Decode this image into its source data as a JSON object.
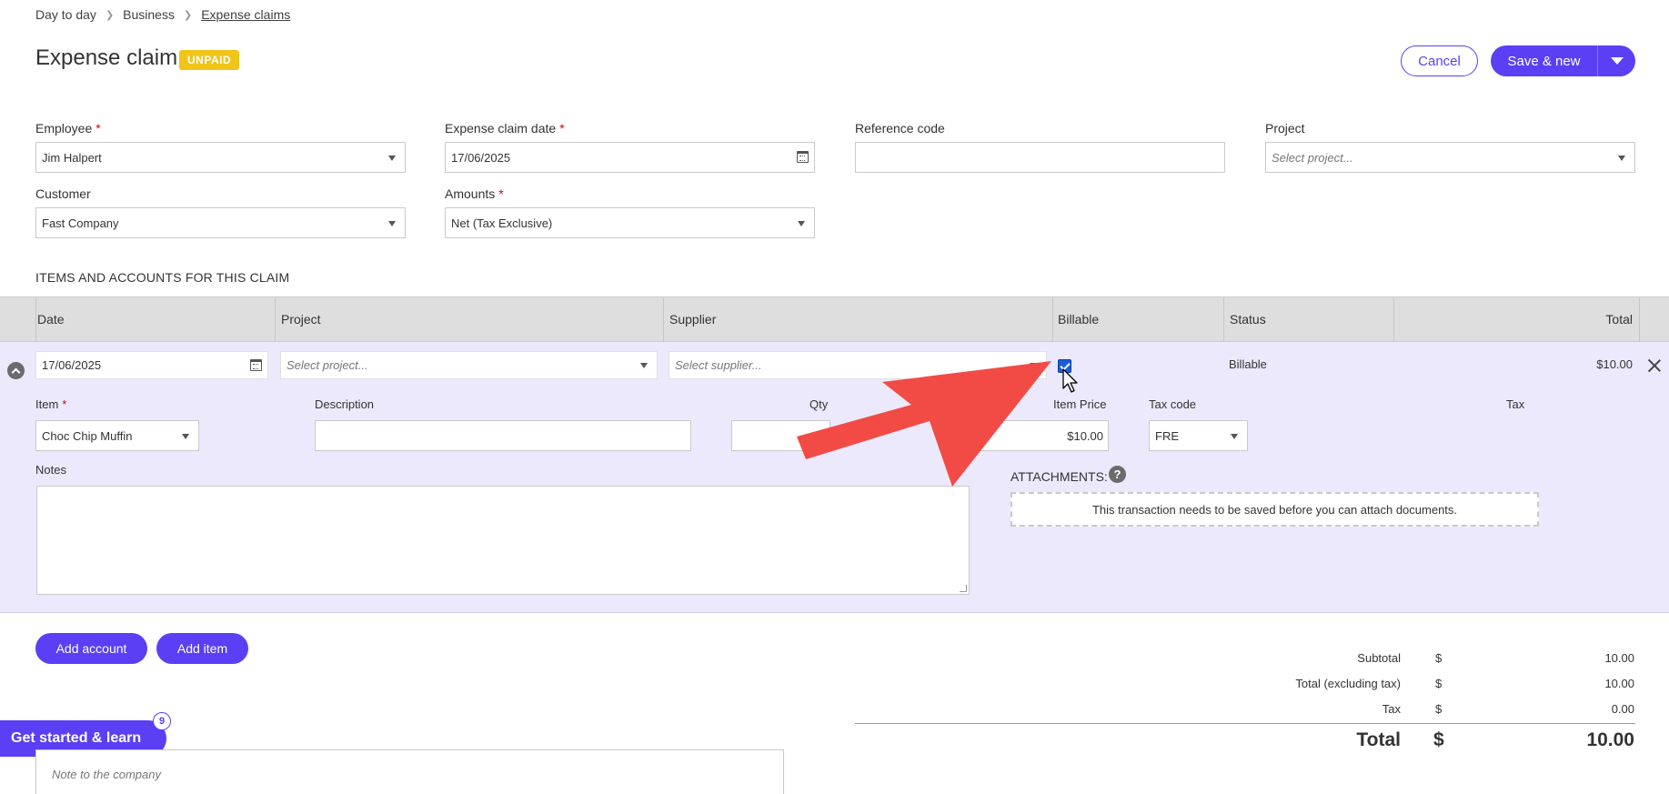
{
  "breadcrumb": {
    "items": [
      "Day to day",
      "Business",
      "Expense claims"
    ]
  },
  "header": {
    "title": "Expense claim",
    "status": "UNPAID",
    "cancel_label": "Cancel",
    "save_label": "Save & new"
  },
  "form": {
    "employee": {
      "label": "Employee",
      "value": "Jim Halpert"
    },
    "claim_date": {
      "label": "Expense claim date",
      "value": "17/06/2025"
    },
    "reference": {
      "label": "Reference code",
      "value": ""
    },
    "project": {
      "label": "Project",
      "placeholder": "Select project..."
    },
    "customer": {
      "label": "Customer",
      "value": "Fast Company"
    },
    "amounts": {
      "label": "Amounts",
      "value": "Net (Tax Exclusive)"
    }
  },
  "items_section": {
    "title": "ITEMS AND ACCOUNTS FOR THIS CLAIM",
    "columns": [
      "Date",
      "Project",
      "Supplier",
      "Billable",
      "Status",
      "Total"
    ]
  },
  "line": {
    "date": "17/06/2025",
    "project_placeholder": "Select project...",
    "supplier_placeholder": "Select supplier...",
    "billable": true,
    "status": "Billable",
    "total": "$10.00",
    "item_label": "Item",
    "item_value": "Choc Chip Muffin",
    "description_label": "Description",
    "qty_label": "Qty",
    "item_price_label": "Item Price",
    "item_price_value": "$10.00",
    "tax_code_label": "Tax code",
    "tax_code_value": "FRE",
    "tax_label": "Tax",
    "notes_label": "Notes",
    "attachments_label": "ATTACHMENTS:",
    "attachments_help": "?",
    "attachments_message": "This transaction needs to be saved before you can attach documents."
  },
  "actions": {
    "add_account": "Add account",
    "add_item": "Add item"
  },
  "summary": {
    "currency": "$",
    "rows": [
      {
        "label": "Subtotal",
        "value": "10.00"
      },
      {
        "label": "Total (excluding tax)",
        "value": "10.00"
      },
      {
        "label": "Tax",
        "value": "0.00"
      }
    ],
    "total_label": "Total",
    "total_value": "10.00"
  },
  "learn": {
    "label": "Get started & learn",
    "badge": "9"
  },
  "note": {
    "placeholder": "Note to the company"
  },
  "colors": {
    "accent": "#5a3ff5",
    "badge": "#f0c419",
    "row_bg": "#ece9fc",
    "annotation": "#f24b45"
  },
  "icons": [
    "chevron-right-icon",
    "calendar-icon",
    "dropdown-caret-icon",
    "collapse-chevron-icon",
    "checkbox-checked-icon",
    "close-icon",
    "help-icon",
    "mouse-cursor-icon",
    "red-arrow-annotation"
  ]
}
